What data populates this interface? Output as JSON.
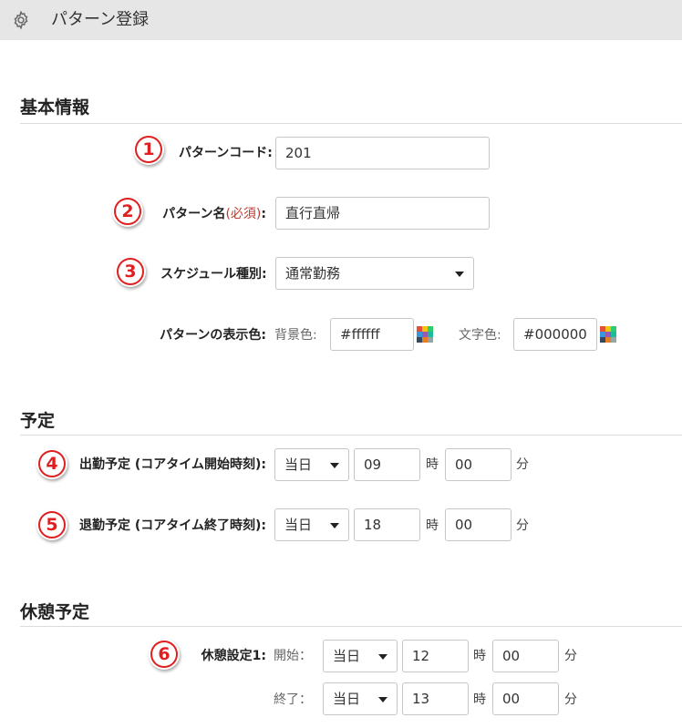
{
  "header": {
    "title": "パターン登録",
    "icon": "gear-icon"
  },
  "sections": {
    "basic": "基本情報",
    "schedule": "予定",
    "break": "休憩予定"
  },
  "basic": {
    "code_label": "パターンコード:",
    "code_value": "201",
    "name_label": "パターン名",
    "name_required": "(必須)",
    "name_colon": ":",
    "name_value": "直行直帰",
    "type_label": "スケジュール種別:",
    "type_value": "通常勤務",
    "color_label": "パターンの表示色:",
    "bg_label": "背景色:",
    "bg_value": "#ffffff",
    "fg_label": "文字色:",
    "fg_value": "#000000"
  },
  "schedule": {
    "start_label": "出勤予定 (コアタイム開始時刻):",
    "start_day": "当日",
    "start_hour": "09",
    "start_min": "00",
    "end_label": "退勤予定 (コアタイム終了時刻):",
    "end_day": "当日",
    "end_hour": "18",
    "end_min": "00"
  },
  "break": {
    "label": "休憩設定1:",
    "start_label": "開始：",
    "start_day": "当日",
    "start_hour": "12",
    "start_min": "00",
    "end_label": "終了：",
    "end_day": "当日",
    "end_hour": "13",
    "end_min": "00"
  },
  "units": {
    "hour": "時",
    "minute": "分"
  },
  "badges": [
    "1",
    "2",
    "3",
    "4",
    "5",
    "6"
  ],
  "colors": {
    "badge": "#e02020",
    "required": "#c0392b",
    "header_bg": "#e6e6e6"
  }
}
